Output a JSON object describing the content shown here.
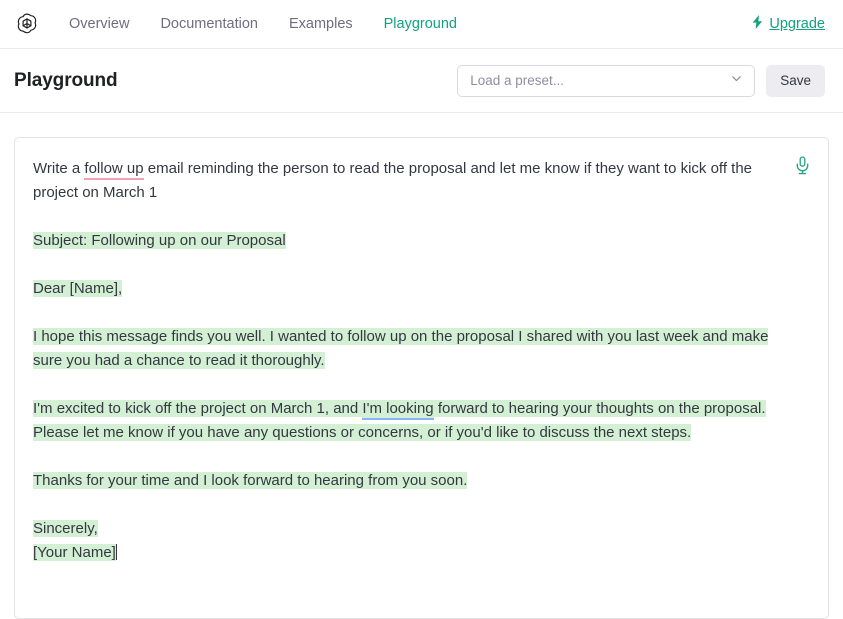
{
  "navbar": {
    "logo_name": "openai-logo",
    "links": [
      {
        "label": "Overview",
        "active": false
      },
      {
        "label": "Documentation",
        "active": false
      },
      {
        "label": "Examples",
        "active": false
      },
      {
        "label": "Playground",
        "active": true
      }
    ],
    "upgrade": {
      "label": "Upgrade",
      "icon": "lightning-bolt-icon",
      "color": "#10a37f"
    }
  },
  "header": {
    "title": "Playground",
    "preset": {
      "placeholder": "Load a preset...",
      "value": "",
      "icon": "chevron-down-icon"
    },
    "save_label": "Save"
  },
  "editor": {
    "mic_icon": "microphone-icon",
    "prompt": {
      "before_spell": "Write a ",
      "spell_word": "follow up",
      "after_spell": " email reminding the person to read the proposal and let me know if they want to kick off the project on March 1"
    },
    "completion": [
      {
        "text": "Subject: Following up on our Proposal"
      },
      {
        "text": "Dear [Name],"
      },
      {
        "text": "I hope this message finds you well. I wanted to follow up on the proposal I shared with you last week and make sure you had a chance to read it thoroughly."
      },
      {
        "pre": "I'm excited to kick off the project on March 1, and ",
        "grammar": "I'm looking",
        "post": " forward to hearing your thoughts on the proposal. Please let me know if you have any questions or concerns, or if you'd like to discuss the next steps."
      },
      {
        "text": "Thanks for your time and I look forward to hearing from you soon."
      },
      {
        "text": "Sincerely,\n[Your Name]"
      }
    ]
  },
  "colors": {
    "accent": "#10a37f",
    "highlight": "#d3f0d5",
    "spellcheck_underline": "#f2a2b4",
    "grammar_underline": "#8ab4f8",
    "text": "#353740",
    "muted": "#6e6e80"
  }
}
